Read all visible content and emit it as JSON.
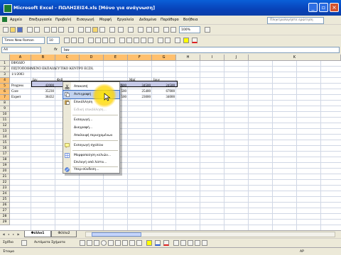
{
  "window": {
    "title": "Microsoft Excel - ΠΩΛΗΣΕΙΣ4.xls  [Μόνο για ανάγνωση]"
  },
  "menu": {
    "items": [
      "Αρχείο",
      "Επεξεργασία",
      "Προβολή",
      "Εισαγωγή",
      "Μορφή",
      "Εργαλεία",
      "Δεδομένα",
      "Παράθυρο",
      "Βοήθεια"
    ],
    "help_placeholder": "Πληκτρολογήστε ερώτηση"
  },
  "toolbar": {
    "zoom": "100%",
    "font_name": "Times New Roman",
    "font_size": "10"
  },
  "formula_bar": {
    "name_box": "A4",
    "fx": "fx",
    "content": "Ιαν"
  },
  "sheet": {
    "columns": [
      "A",
      "B",
      "C",
      "D",
      "E",
      "F",
      "G",
      "H",
      "I",
      "J",
      "K"
    ],
    "rows": [
      "1",
      "2",
      "3",
      "4",
      "5",
      "6",
      "7",
      "8",
      "9",
      "10",
      "11",
      "12",
      "13",
      "14",
      "15",
      "16",
      "17",
      "18",
      "19",
      "20",
      "21",
      "22",
      "23",
      "24",
      "25",
      "26",
      "27",
      "28",
      "29"
    ],
    "cells": {
      "a1": "ΕΦΟΔΙΟ",
      "a2": "ΠΙΣΤΟΠΟΙΗΜΕΝΟ ΕΚΠΑΙΔΕΥΤΙΚΟ ΚΕΝΤΡΟ ECDL",
      "a3": "1/1/2003",
      "b4": "Ιαν",
      "c4": "Φεβ",
      "f4": "Μαϊ",
      "g4": "Ιουν",
      "a5": "Progress",
      "b5": "42000",
      "e5": "600",
      "f5": "34500",
      "g5": "24500",
      "a6": "Core",
      "b6": "35230",
      "e6": "500",
      "f6": "25400",
      "g6": "67000",
      "a7": "Expert",
      "b7": "38432",
      "e7": "500",
      "f7": "23000",
      "g7": "34000"
    }
  },
  "context_menu": {
    "items": [
      {
        "label": "Αποκοπή",
        "disabled": false,
        "icon": "cut-icon"
      },
      {
        "label": "Αντιγραφή",
        "disabled": false,
        "icon": "copy-icon"
      },
      {
        "label": "Επικόλληση",
        "disabled": false,
        "icon": "paste-icon"
      },
      {
        "label": "Ειδική επικόλληση...",
        "disabled": true,
        "icon": ""
      },
      {
        "label": "Εισαγωγή...",
        "disabled": false,
        "icon": ""
      },
      {
        "label": "Διαγραφή...",
        "disabled": false,
        "icon": ""
      },
      {
        "label": "Απαλοιφή περιεχομένων",
        "disabled": false,
        "icon": ""
      },
      {
        "label": "Εισαγωγή σχολίου",
        "disabled": false,
        "icon": "comment-icon"
      },
      {
        "label": "Μορφοποίηση κελιών...",
        "disabled": false,
        "icon": "format-cells-icon"
      },
      {
        "label": "Επιλογή από λίστα...",
        "disabled": false,
        "icon": ""
      },
      {
        "label": "Υπερ-σύνδεση...",
        "disabled": false,
        "icon": "hyperlink-icon"
      }
    ]
  },
  "tabs": {
    "active": "Φύλλο1",
    "other": "Φύλλο2"
  },
  "draw_toolbar": {
    "draw": "Σχέδιο",
    "autoshapes": "Αυτόματα Σχήματα"
  },
  "status": {
    "left": "Έτοιμο",
    "right": "ΑΡ"
  }
}
